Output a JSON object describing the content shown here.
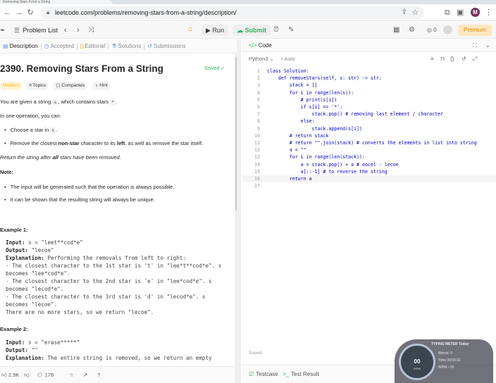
{
  "browser": {
    "tab_title": "Removing Stars From a String",
    "url": "leetcode.com/problems/removing-stars-from-a-string/description/",
    "profile_initial": "M"
  },
  "toolbar": {
    "problem_list": "Problem List",
    "run": "Run",
    "submit": "Submit",
    "coins": "0",
    "premium": "Premium"
  },
  "tabs": [
    {
      "icon": "doc-icon",
      "label": "Description"
    },
    {
      "icon": "clock-icon",
      "label": "Accepted"
    },
    {
      "icon": "book-icon",
      "label": "Editorial"
    },
    {
      "icon": "flask-icon",
      "label": "Solutions"
    },
    {
      "icon": "history-icon",
      "label": "Submissions"
    }
  ],
  "problem": {
    "title": "2390. Removing Stars From a String",
    "status": "Solved",
    "difficulty": "Medium",
    "chips": [
      "Topics",
      "Companies",
      "Hint"
    ],
    "intro_1": "You are given a string",
    "intro_s": "s",
    "intro_2": ", which contains stars",
    "intro_star": "*",
    "intro_3": ".",
    "operation": "In one operation, you can:",
    "bullet1_a": "Choose a star in",
    "bullet1_s": "s",
    "bullet1_b": ".",
    "bullet2_a": "Remove the closest",
    "bullet2_bold1": "non-star",
    "bullet2_b": "character to its",
    "bullet2_bold2": "left",
    "bullet2_c": ", as well as remove the star itself.",
    "return_a": "Return the string after",
    "return_bold": "all",
    "return_b": "stars have been removed.",
    "note": "Note:",
    "note1": "The input will be generated such that the operation is always possible.",
    "note2": "It can be shown that the resulting string will always be unique.",
    "example1": "Example 1:",
    "ex1_input_label": "Input:",
    "ex1_input": " s = \"leet**cod*e\"",
    "ex1_output_label": "Output:",
    "ex1_output": " \"lecoe\"",
    "ex1_expl_label": "Explanation:",
    "ex1_expl": " Performing the removals from left to right:",
    "ex1_l1": "- The closest character to the 1st star is 't' in \"lee*t**cod*e\". s",
    "ex1_l2": "becomes \"lee*cod*e\".",
    "ex1_l3": "- The closest character to the 2nd star is 'e' in \"lee*cod*e\". s",
    "ex1_l4": "becomes \"lecod*e\".",
    "ex1_l5": "- The closest character to the 3rd star is 'd' in \"lecod*e\". s",
    "ex1_l6": "becomes \"lecoe\".",
    "ex1_l7": "There are no more stars, so we return \"lecoe\".",
    "example2": "Example 2:",
    "ex2_input_label": "Input:",
    "ex2_input": " s = \"erase*****\"",
    "ex2_output_label": "Output:",
    "ex2_output": " \"\"",
    "ex2_expl_label": "Explanation:",
    "ex2_expl": " The entire string is removed, so we return an empty"
  },
  "footer": {
    "likes": "2.9K",
    "comments": "176"
  },
  "editor": {
    "title": "Code",
    "language": "Python3",
    "autocomplete": "Auto",
    "saved": "Saved",
    "active_line": 16,
    "lines": [
      "class Solution:",
      "    def removeStars(self, s: str) -> str:",
      "        stack = []",
      "        for i in range(len(s)):",
      "            # print(s[i])",
      "            if s[i] == '*':",
      "                stack.pop() # removing last element / character",
      "            else:",
      "                stack.append(s[i])",
      "        # return stack",
      "        # return \"\".join(stack) # converts the elements in list into string",
      "        a = \"\"",
      "        for i in range(len(stack)):",
      "            a = stack.pop() + a # eocel - lecoe",
      "            a[::-1] # to reverse the string",
      "        return a",
      ""
    ]
  },
  "test_bar": {
    "testcase": "Testcase",
    "result": "Test Result"
  },
  "typing_meter": {
    "title": "TYPING METER Today",
    "gauge_value": "00",
    "gauge_unit": "WPM",
    "words_label": "Words",
    "words_value": "0",
    "time_label": "Time",
    "time_value": "00:00:31",
    "wpm_label": "WPM",
    "wpm_value": "~78"
  }
}
